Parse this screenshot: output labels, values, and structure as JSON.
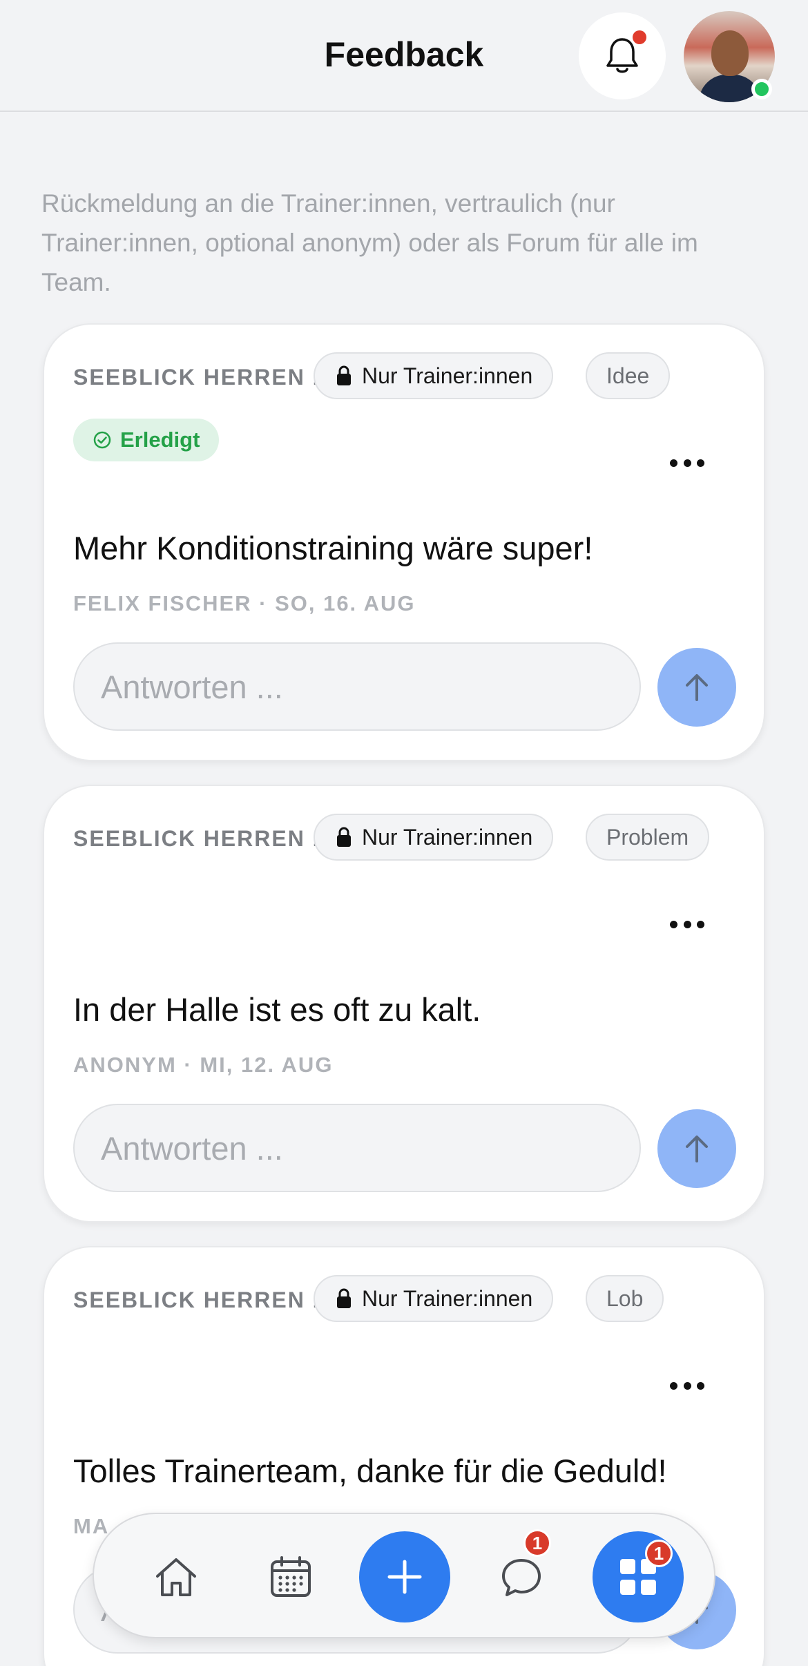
{
  "header": {
    "title": "Feedback"
  },
  "intro": "Rückmeldung an die Trainer:innen, vertraulich (nur Trainer:innen, optional anonym) oder als Forum für alle im Team.",
  "cards": [
    {
      "team": "SEEBLICK HERREN 1",
      "visibility": "Nur Trainer:innen",
      "category": "Idee",
      "status": "Erledigt",
      "message": "Mehr Konditionstraining wäre super!",
      "meta": "FELIX FISCHER · SO, 16. AUG",
      "reply_placeholder": "Antworten ..."
    },
    {
      "team": "SEEBLICK HERREN 1",
      "visibility": "Nur Trainer:innen",
      "category": "Problem",
      "message": "In der Halle ist es oft zu kalt.",
      "meta": "ANONYM · MI, 12. AUG",
      "reply_placeholder": "Antworten ..."
    },
    {
      "team": "SEEBLICK HERREN 1",
      "visibility": "Nur Trainer:innen",
      "category": "Lob",
      "message": "Tolles Trainerteam, danke für die Geduld!",
      "meta": "MA",
      "reply_placeholder": "A"
    }
  ],
  "tabbar": {
    "chat_badge": "1",
    "more_badge": "1",
    "accent_color": "#2e7cf0",
    "icons": [
      "home-icon",
      "calendar-icon",
      "plus-icon",
      "chat-icon",
      "grid-icon"
    ]
  }
}
